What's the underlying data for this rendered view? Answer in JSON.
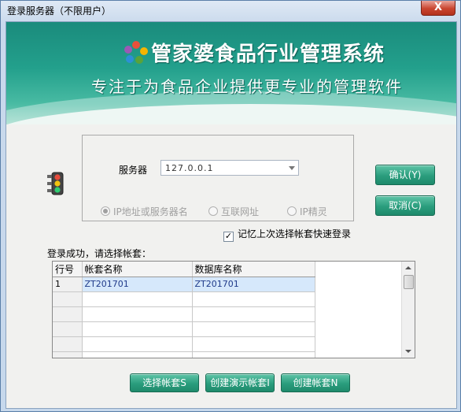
{
  "window": {
    "title": "登录服务器（不限用户）",
    "close_glyph": "X"
  },
  "banner": {
    "title": "管家婆食品行业管理系统",
    "subtitle": "专注于为食品企业提供更专业的管理软件",
    "logo_colors": [
      "#e8503a",
      "#f5b400",
      "#5aa33a",
      "#2d8fd6",
      "#9b59b6"
    ]
  },
  "server": {
    "label": "服务器",
    "value": "127.0.0.1",
    "options": [
      {
        "label": "IP地址或服务器名",
        "selected": true
      },
      {
        "label": "互联网址",
        "selected": false
      },
      {
        "label": "IP精灵",
        "selected": false
      }
    ]
  },
  "buttons": {
    "confirm": "确认(Y)",
    "cancel": "取消(C)",
    "select_account": "选择帐套S",
    "create_demo": "创建演示帐套I",
    "create_account": "创建帐套N"
  },
  "remember": {
    "label": "记忆上次选择帐套快速登录",
    "checked": true
  },
  "status": "登录成功，请选择帐套：",
  "accounts_table": {
    "columns": [
      "行号",
      "帐套名称",
      "数据库名称"
    ],
    "rows": [
      {
        "row": "1",
        "name": "ZT201701",
        "db": "ZT201701",
        "selected": true
      }
    ],
    "empty_rows": 5
  }
}
